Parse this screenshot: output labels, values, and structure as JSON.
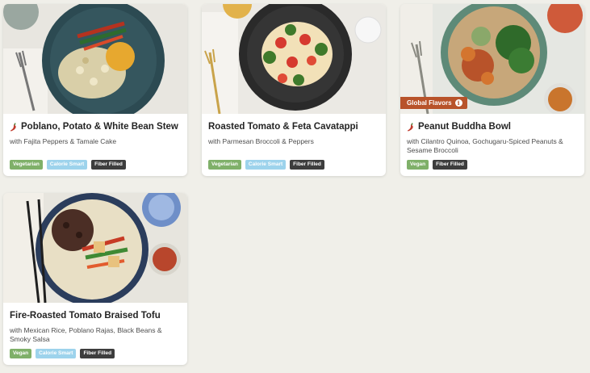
{
  "colors": {
    "page_bg": "#f0efe9",
    "vegetarian_tag": "#7fb069",
    "calorie_smart_tag": "#9dd3ec",
    "fiber_filled_tag": "#3d3d3d",
    "global_flavors_badge": "#b8532a",
    "chili": "#c0392b"
  },
  "recipes": [
    {
      "title": "Poblano, Potato & White Bean Stew",
      "subtitle": "with Fajita Peppers & Tamale Cake",
      "spicy_icon": "chili-pepper-icon",
      "tags": [
        "Vegetarian",
        "Calorie Smart",
        "Fiber Filled"
      ]
    },
    {
      "title": "Roasted Tomato & Feta Cavatappi",
      "subtitle": "with Parmesan Broccoli & Peppers",
      "tags": [
        "Vegetarian",
        "Calorie Smart",
        "Fiber Filled"
      ]
    },
    {
      "title": "Peanut Buddha Bowl",
      "subtitle": "with Cilantro Quinoa, Gochugaru-Spiced Peanuts & Sesame Broccoli",
      "spicy_icon": "chili-pepper-icon",
      "badge": "Global Flavors",
      "badge_icon": "info-icon",
      "tags": [
        "Vegan",
        "Fiber Filled"
      ]
    },
    {
      "title": "Fire-Roasted Tomato Braised Tofu",
      "subtitle": "with Mexican Rice, Poblano Rajas, Black Beans & Smoky Salsa",
      "tags": [
        "Vegan",
        "Calorie Smart",
        "Fiber Filled"
      ]
    }
  ]
}
